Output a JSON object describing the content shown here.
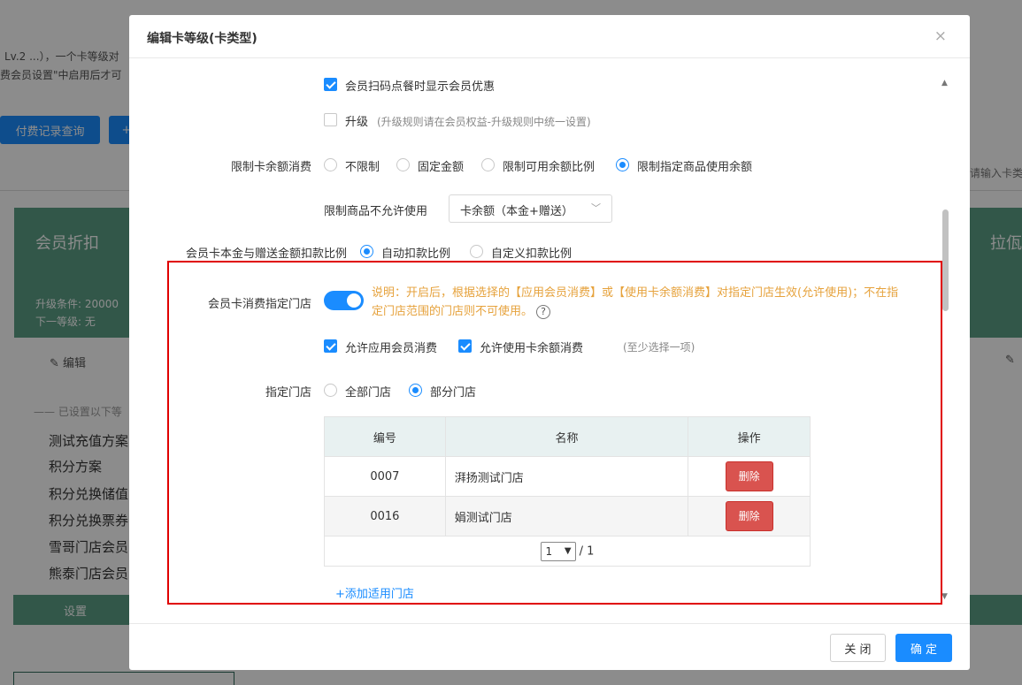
{
  "background": {
    "top_text_1": "Lv.2 ...），一个卡等级对",
    "top_text_2": "费会员设置\"中启用后才可",
    "pay_query_button": "付费记录查询",
    "plus_button": "+",
    "search_placeholder": "请输入卡类",
    "card_title": "会员折扣",
    "card_title_right": "拉佤",
    "upgrade_cond": "升级条件: 20000",
    "next_level": "下一等级: 无",
    "edit_label": "编辑",
    "set_prefix": "—— 已设置以下等",
    "plans": [
      "测试充值方案",
      "积分方案",
      "积分兑换储值",
      "积分兑换票券",
      "雪哥门店会员",
      "熊泰门店会员"
    ],
    "set_button": "设置"
  },
  "modal": {
    "title": "编辑卡等级(卡类型)",
    "close_icon": "×",
    "show_discount_label": "会员扫码点餐时显示会员优惠",
    "show_discount_checked": true,
    "upgrade_label": "升级",
    "upgrade_hint": "(升级规则请在会员权益-升级规则中统一设置)",
    "upgrade_checked": false,
    "limit_balance_label": "限制卡余额消费",
    "limit_options": [
      "不限制",
      "固定金额",
      "限制可用余额比例",
      "限制指定商品使用余额"
    ],
    "limit_selected_index": 3,
    "restrict_goods_label": "限制商品不允许使用",
    "restrict_goods_value": "卡余额（本金+赠送）",
    "ratio_label": "会员卡本金与赠送金额扣款比例",
    "ratio_options": [
      "自动扣款比例",
      "自定义扣款比例"
    ],
    "ratio_selected_index": 0,
    "store_consume_label": "会员卡消费指定门店",
    "store_consume_on": true,
    "note_line1": "说明：开启后，根据选择的【应用会员消费】或【使用卡余额消费】对指定门店生效(允许使用)；不在指",
    "note_line2": "定门店范围的门店则不可使用。",
    "help_icon": "?",
    "allow_member_label": "允许应用会员消费",
    "allow_balance_label": "允许使用卡余额消费",
    "allow_hint": "(至少选择一项)",
    "stores_label": "指定门店",
    "stores_options": [
      "全部门店",
      "部分门店"
    ],
    "stores_selected_index": 1,
    "table": {
      "headers": [
        "编号",
        "名称",
        "操作"
      ],
      "rows": [
        {
          "code": "0007",
          "name": "湃扬测试门店",
          "action": "删除"
        },
        {
          "code": "0016",
          "name": "娟测试门店",
          "action": "删除"
        }
      ],
      "page_value": "1",
      "page_total": "/ 1"
    },
    "add_store_link": "+添加适用门店",
    "footer": {
      "close_button": "关 闭",
      "confirm_button": "确 定"
    }
  },
  "colors": {
    "accent": "#1a8cff",
    "warning": "#e6a23c",
    "danger": "#d9534f",
    "highlight": "#e00000",
    "card_green": "#5b9e86"
  }
}
